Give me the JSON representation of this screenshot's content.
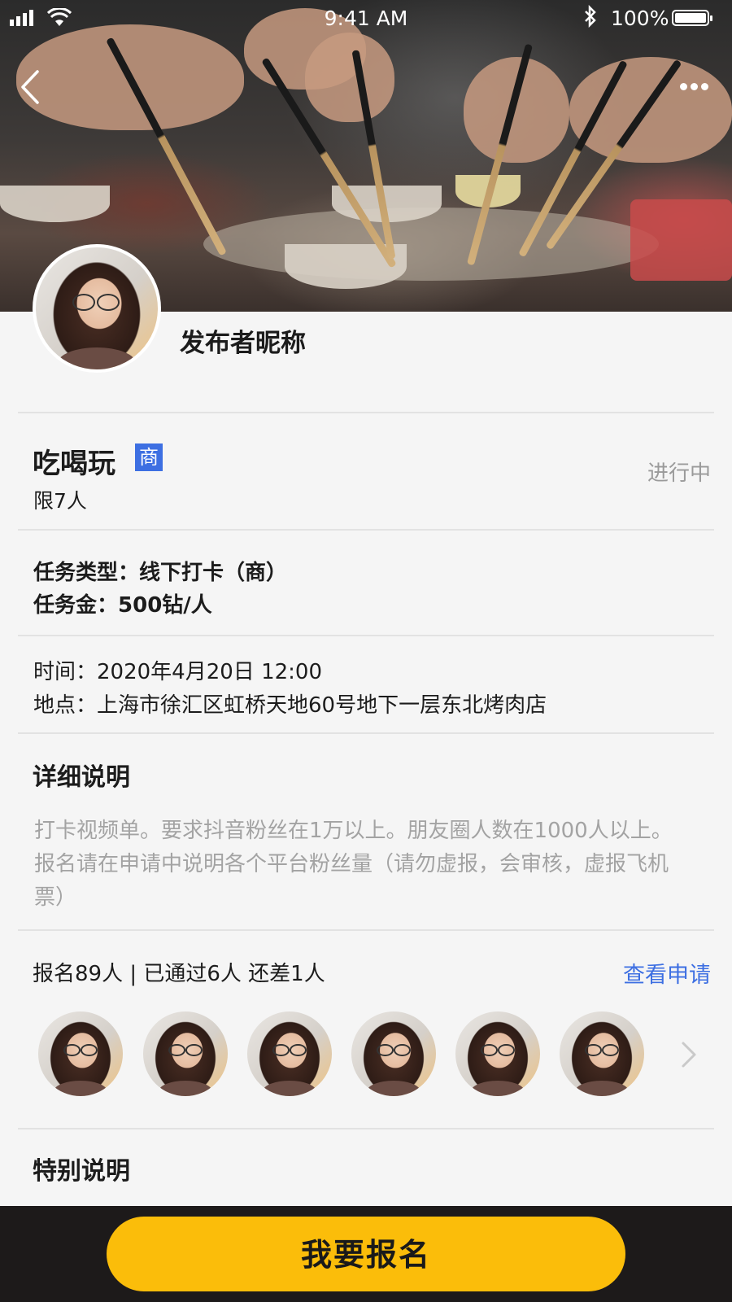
{
  "status_bar": {
    "time": "9:41 AM",
    "battery": "100%"
  },
  "header": {
    "back_icon": "chevron-left-icon",
    "more_icon": "more-horizontal-icon"
  },
  "publisher": {
    "name": "发布者昵称"
  },
  "task": {
    "title": "吃喝玩",
    "badge": "商",
    "limit": "限7人",
    "status": "进行中",
    "type_label": "任务类型：",
    "type_value": "线下打卡（商）",
    "reward_label": "任务金：",
    "reward_value": "500钻/人",
    "time_label": "时间：",
    "time_value": "2020年4月20日 12:00",
    "location_label": "地点：",
    "location_value": "上海市徐汇区虹桥天地60号地下一层东北烤肉店"
  },
  "details": {
    "title": "详细说明",
    "text": "打卡视频单。要求抖音粉丝在1万以上。朋友圈人数在1000人以上。报名请在申请中说明各个平台粉丝量（请勿虚报，会审核，虚报飞机票）"
  },
  "applications": {
    "summary": "报名89人 | 已通过6人 还差1人",
    "view_link": "查看申请",
    "avatar_count": 6
  },
  "special": {
    "title": "特别说明"
  },
  "cta": {
    "label": "我要报名"
  },
  "colors": {
    "accent_blue": "#3d6fe2",
    "cta_yellow": "#fbbd0a",
    "bottom_bar": "#1d1a1a",
    "muted_text": "#9a9a9a"
  }
}
